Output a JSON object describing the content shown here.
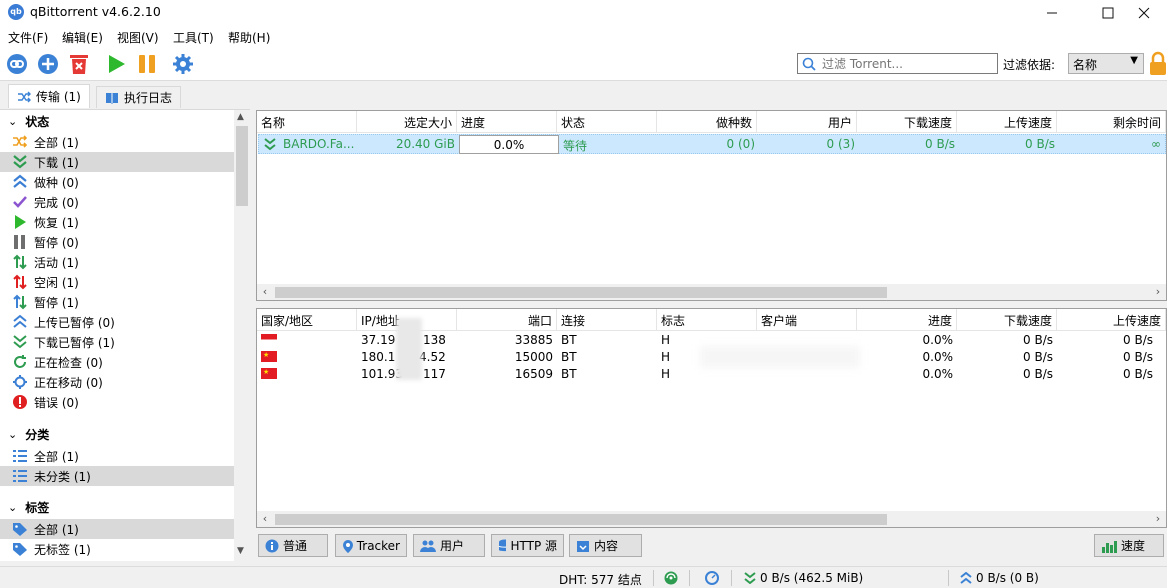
{
  "window": {
    "title": "qBittorrent v4.6.2.10",
    "icon_text": "qb"
  },
  "menu": [
    "文件(F)",
    "编辑(E)",
    "视图(V)",
    "工具(T)",
    "帮助(H)"
  ],
  "toolbar": {
    "buttons": [
      "add-link-icon",
      "add-torrent-icon",
      "delete-icon",
      "resume-icon",
      "pause-icon",
      "options-icon"
    ],
    "filter_placeholder": "过滤 Torrent...",
    "filter_by_label": "过滤依据:",
    "filter_by_value": "名称"
  },
  "tabs": [
    {
      "label": "传输 (1)"
    },
    {
      "label": "执行日志"
    }
  ],
  "sidebar": {
    "status_title": "状态",
    "status_items": [
      {
        "label": "全部 (1)",
        "icon": "shuffle-icon",
        "color": "#f0a020"
      },
      {
        "label": "下载 (1)",
        "icon": "download-icon",
        "color": "#2e9c50"
      },
      {
        "label": "做种 (0)",
        "icon": "upload-icon",
        "color": "#3b7fd4"
      },
      {
        "label": "完成 (0)",
        "icon": "check-icon",
        "color": "#8c55d0"
      },
      {
        "label": "恢复 (1)",
        "icon": "play-icon",
        "color": "#2eb82e"
      },
      {
        "label": "暂停 (0)",
        "icon": "pause-icon",
        "color": "#6e6e6e"
      },
      {
        "label": "活动 (1)",
        "icon": "active-icon",
        "color": "#2e9c50"
      },
      {
        "label": "空闲 (1)",
        "icon": "inactive-icon",
        "color": "#e02020"
      },
      {
        "label": "暂停 (1)",
        "icon": "stalled-icon",
        "color": "#2e9c50"
      },
      {
        "label": "上传已暂停 (0)",
        "icon": "upload-stalled-icon",
        "color": "#3b7fd4"
      },
      {
        "label": "下载已暂停 (1)",
        "icon": "download-stalled-icon",
        "color": "#2e9c50"
      },
      {
        "label": "正在检查 (0)",
        "icon": "checking-icon",
        "color": "#2e9c50"
      },
      {
        "label": "正在移动 (0)",
        "icon": "moving-icon",
        "color": "#3b7fd4"
      },
      {
        "label": "错误 (0)",
        "icon": "error-icon",
        "color": "#e02020"
      }
    ],
    "category_title": "分类",
    "category_items": [
      {
        "label": "全部 (1)"
      },
      {
        "label": "未分类 (1)"
      }
    ],
    "tag_title": "标签",
    "tag_items": [
      {
        "label": "全部 (1)"
      },
      {
        "label": "无标签 (1)"
      }
    ]
  },
  "torrents": {
    "headers": [
      "名称",
      "选定大小",
      "进度",
      "状态",
      "做种数",
      "用户",
      "下载速度",
      "上传速度",
      "剩余时间"
    ],
    "rows": [
      {
        "name": "BARDO.Fa...",
        "size": "20.40 GiB",
        "progress": "0.0%",
        "status": "等待",
        "seeds": "0 (0)",
        "peers": "0 (3)",
        "down": "0 B/s",
        "up": "0 B/s",
        "eta": "∞"
      }
    ]
  },
  "peers": {
    "headers": [
      "国家/地区",
      "IP/地址",
      "端口",
      "连接",
      "标志",
      "客户端",
      "进度",
      "下载速度",
      "上传速度"
    ],
    "rows": [
      {
        "flag": "sg",
        "ip": "37.19",
        "ip_tail": "138",
        "port": "33885",
        "conn": "BT",
        "flags": "H",
        "progress": "0.0%",
        "down": "0 B/s",
        "up": "0 B/s"
      },
      {
        "flag": "cn",
        "ip": "180.1",
        "ip_tail": "4.52",
        "port": "15000",
        "conn": "BT",
        "flags": "H",
        "progress": "0.0%",
        "down": "0 B/s",
        "up": "0 B/s"
      },
      {
        "flag": "cn",
        "ip": "101.93",
        "ip_tail": "117",
        "port": "16509",
        "conn": "BT",
        "flags": "H",
        "progress": "0.0%",
        "down": "0 B/s",
        "up": "0 B/s"
      }
    ]
  },
  "panel_tabs": [
    "普通",
    "Tracker",
    "用户",
    "HTTP 源",
    "内容"
  ],
  "speed_button": "速度",
  "status": {
    "dht": "DHT:  577 结点",
    "download": "0 B/s (462.5 MiB)",
    "upload": "0 B/s (0 B)"
  }
}
